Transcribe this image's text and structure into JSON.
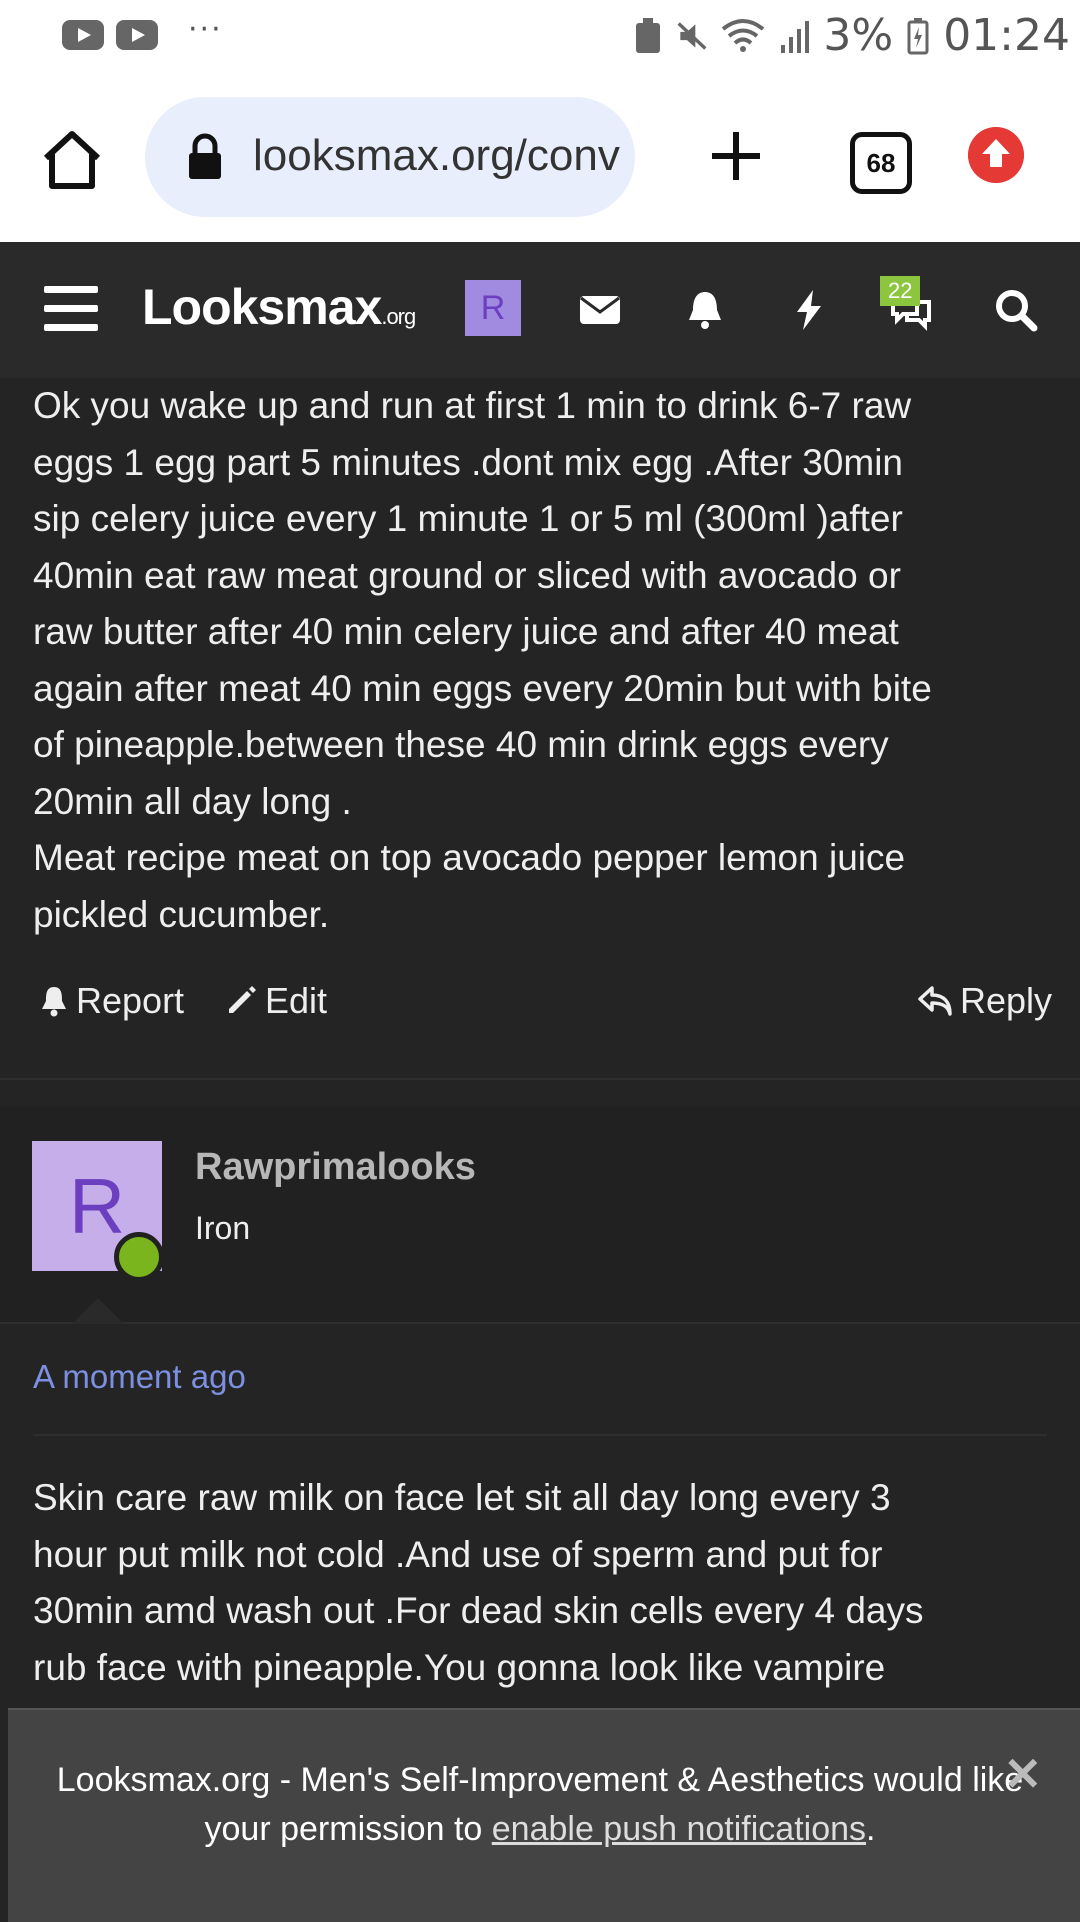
{
  "status_bar": {
    "battery": "3%",
    "time": "01:24",
    "overflow": "···"
  },
  "browser": {
    "url": "looksmax.org/conv",
    "tab_count": "68"
  },
  "site_header": {
    "logo_main": "Looksmax",
    "logo_suffix": ".org",
    "user_initial": "R",
    "conversations_badge": "22"
  },
  "post1": {
    "lines": [
      "Ok you wake up and run at first 1 min to drink 6-7 raw",
      "eggs 1 egg part 5 minutes .dont mix egg .After 30min",
      "sip celery juice every 1 minute 1 or 5 ml (300ml )after",
      "40min eat raw meat ground or sliced with avocado or",
      "raw butter after 40 min celery juice and after 40 meat",
      "again after meat 40 min eggs every 20min but with bite",
      "of pineapple.between these 40 min drink eggs every",
      "20min all day long .",
      "Meat recipe meat on top avocado pepper lemon juice",
      "pickled cucumber."
    ],
    "report_label": "Report",
    "edit_label": "Edit",
    "reply_label": "Reply"
  },
  "post2": {
    "avatar_initial": "R",
    "username": "Rawprimalooks",
    "rank": "Iron",
    "time": "A moment ago",
    "lines": [
      "Skin care raw milk on face let sit all day long every 3",
      "hour put milk not cold .And use of sperm and put for",
      "30min amd wash out .For dead skin cells every 4 days",
      "rub face with pineapple.You gonna look like vampire"
    ]
  },
  "push_banner": {
    "text_before": "Looksmax.org - Men's Self-Improvement & Aesthetics would like your permission to ",
    "link_text": "enable push notifications",
    "text_after": ".",
    "close_symbol": "✕"
  },
  "colors": {
    "accent_link": "#7c8fe0",
    "badge_green": "#8cc63e",
    "online_green": "#7ab51d",
    "avatar_purple": "#c5aeea"
  }
}
